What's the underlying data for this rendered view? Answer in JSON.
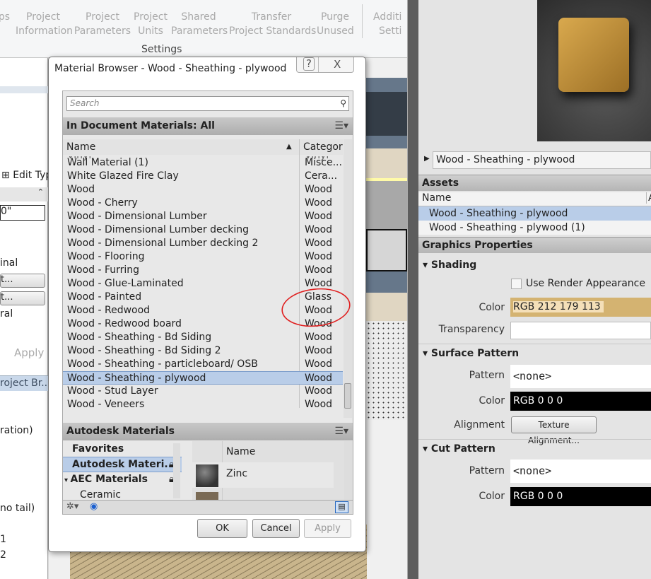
{
  "ribbon": {
    "items": [
      {
        "l1": "ps",
        "l2": ""
      },
      {
        "l1": "Project",
        "l2": "Information"
      },
      {
        "l1": "Project",
        "l2": "Parameters"
      },
      {
        "l1": "Project",
        "l2": "Units"
      },
      {
        "l1": "Shared",
        "l2": "Parameters"
      },
      {
        "l1": "Transfer",
        "l2": "Project Standards"
      },
      {
        "l1": "Purge",
        "l2": "Unused"
      },
      {
        "l1": "Additi",
        "l2": "Setti"
      }
    ],
    "panel_label": "Settings"
  },
  "properties": {
    "edit_type": "Edit Typ",
    "value1": "0\"",
    "value2": "inal",
    "btn1": "t...",
    "btn2": "t...",
    "value3": "ral",
    "apply": "Apply"
  },
  "project_browser": {
    "title": "roject Br...",
    "items": [
      "ration)",
      "no tail)",
      "1",
      "2"
    ]
  },
  "dialog": {
    "title": "Material Browser - Wood - Sheathing - plywood",
    "help": "?",
    "close": "X",
    "search_placeholder": "Search",
    "doc_header": "In Document Materials: All",
    "col_name": "Name",
    "col_category": "Categor",
    "rows": [
      {
        "name": "Wall Material (1)",
        "category": "Misce..."
      },
      {
        "name": "White Glazed Fire Clay",
        "category": "Cera..."
      },
      {
        "name": "Wood",
        "category": "Wood"
      },
      {
        "name": "Wood - Cherry",
        "category": "Wood"
      },
      {
        "name": "Wood - Dimensional Lumber",
        "category": "Wood"
      },
      {
        "name": "Wood - Dimensional Lumber decking",
        "category": "Wood"
      },
      {
        "name": "Wood - Dimensional Lumber decking 2",
        "category": "Wood"
      },
      {
        "name": "Wood - Flooring",
        "category": "Wood"
      },
      {
        "name": "Wood - Furring",
        "category": "Wood"
      },
      {
        "name": "Wood - Glue-Laminated",
        "category": "Wood"
      },
      {
        "name": "Wood - Painted",
        "category": "Glass"
      },
      {
        "name": "Wood - Redwood",
        "category": "Wood"
      },
      {
        "name": "Wood - Redwood board",
        "category": "Wood"
      },
      {
        "name": "Wood - Sheathing - Bd Siding",
        "category": "Wood"
      },
      {
        "name": "Wood - Sheathing - Bd Siding 2",
        "category": "Wood"
      },
      {
        "name": "Wood - Sheathing - particleboard/ OSB",
        "category": "Wood"
      },
      {
        "name": "Wood - Sheathing - plywood",
        "category": "Wood",
        "selected": true
      },
      {
        "name": "Wood - Stud Layer",
        "category": "Wood"
      },
      {
        "name": "Wood - Veneers",
        "category": "Wood"
      }
    ],
    "lib_header": "Autodesk Materials",
    "tree": [
      "Favorites",
      "Autodesk Materi...",
      "AEC Materials",
      "Ceramic"
    ],
    "lib_col_name": "Name",
    "lib_items": [
      "Zinc"
    ],
    "ok": "OK",
    "cancel": "Cancel",
    "apply": "Apply"
  },
  "editor": {
    "material_name": "Wood - Sheathing - plywood",
    "assets_header": "Assets",
    "assets_col": "Name",
    "assets_col2": "A",
    "assets": [
      "Wood - Sheathing - plywood",
      "Wood - Sheathing - plywood (1)"
    ],
    "graphics_header": "Graphics Properties",
    "shading": "Shading",
    "use_render": "Use Render Appearance",
    "color_label": "Color",
    "shading_color": "RGB 212 179 113",
    "transparency_label": "Transparency",
    "surface_pattern": "Surface Pattern",
    "pattern_label": "Pattern",
    "surface_pattern_value": "<none>",
    "surface_color": "RGB 0 0 0",
    "alignment_label": "Alignment",
    "texture_alignment": "Texture Alignment...",
    "cut_pattern": "Cut Pattern",
    "cut_pattern_value": "<none>",
    "cut_color": "RGB 0 0 0"
  },
  "colors": {
    "shading": "#d4b371",
    "selection": "#b9cde8",
    "annotation": "#e02020"
  }
}
